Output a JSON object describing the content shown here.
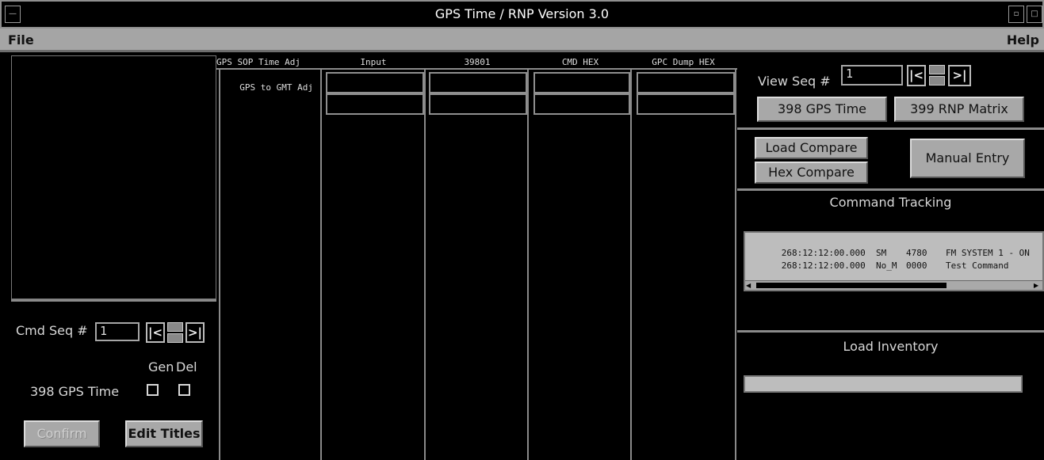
{
  "window": {
    "title": "GPS Time / RNP Version 3.0"
  },
  "menu": {
    "file": "File",
    "help": "Help"
  },
  "table": {
    "headers": [
      "GPS SOP Time Adj",
      "Input",
      "39801",
      "CMD HEX",
      "GPC Dump HEX"
    ],
    "row_label": "GPS to GMT Adj"
  },
  "cmd_panel": {
    "label": "Cmd Seq #",
    "seq_value": "1",
    "first": "|<",
    "last": ">|",
    "gen_label": "Gen",
    "del_label": "Del",
    "item_label": "398 GPS Time",
    "confirm": "Confirm",
    "edit_titles": "Edit Titles"
  },
  "view_panel": {
    "label": "View Seq #",
    "seq_value": "1",
    "first": "|<",
    "last": ">|",
    "btn_398": "398 GPS Time",
    "btn_399": "399 RNP Matrix"
  },
  "compare": {
    "load_compare": "Load Compare",
    "hex_compare": "Hex Compare",
    "manual_entry": "Manual Entry"
  },
  "command_tracking": {
    "title": "Command Tracking",
    "rows": [
      {
        "time": "268:12:12:00.000",
        "src": "SM",
        "code": "4780",
        "desc": "FM SYSTEM 1 - ON"
      },
      {
        "time": "268:12:12:00.000",
        "src": "No_M",
        "code": "0000",
        "desc": "Test Command"
      }
    ]
  },
  "load_inventory": {
    "title": "Load Inventory"
  }
}
